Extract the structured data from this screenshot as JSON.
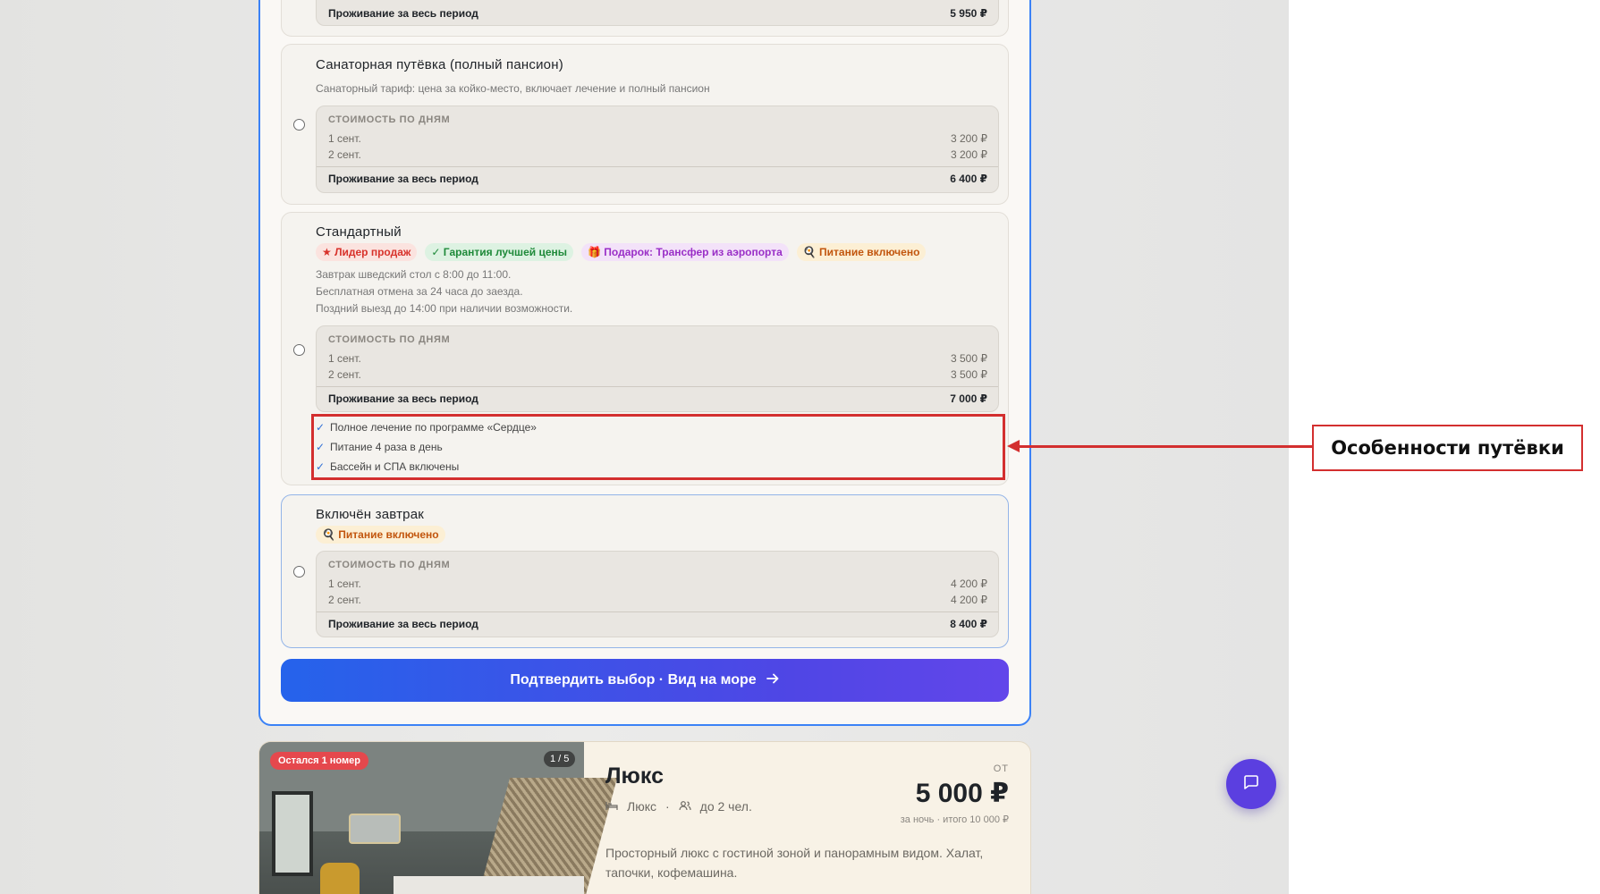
{
  "options": [
    {
      "title": "",
      "total_label": "Проживание за весь период",
      "total_value": "5 950 ₽"
    },
    {
      "title": "Санаторная путёвка (полный пансион)",
      "description": "Санаторный тариф: цена за койко-место, включает лечение и полный пансион",
      "price_header": "СТОИМОСТЬ ПО ДНЯМ",
      "days": [
        {
          "date": "1 сент.",
          "price": "3 200 ₽"
        },
        {
          "date": "2 сент.",
          "price": "3 200 ₽"
        }
      ],
      "total_label": "Проживание за весь период",
      "total_value": "6 400 ₽"
    },
    {
      "title": "Стандартный",
      "badges": [
        {
          "text": "★ Лидер продаж",
          "color": "#d8322b"
        },
        {
          "text": "✓ Гарантия лучшей цены",
          "color": "#1f8a3a"
        },
        {
          "text": "🎁 Подарок: Трансфер из аэропорта",
          "color": "#9a2fc7"
        },
        {
          "text": "🍳 Питание включено",
          "color": "#c2560e"
        }
      ],
      "description_lines": [
        "Завтрак шведский стол с 8:00 до 11:00.",
        "Бесплатная отмена за 24 часа до заезда.",
        "Поздний выезд до 14:00 при наличии возможности."
      ],
      "price_header": "СТОИМОСТЬ ПО ДНЯМ",
      "days": [
        {
          "date": "1 сент.",
          "price": "3 500 ₽"
        },
        {
          "date": "2 сент.",
          "price": "3 500 ₽"
        }
      ],
      "total_label": "Проживание за весь период",
      "total_value": "7 000 ₽",
      "features": [
        "Полное лечение по программе «Сердце»",
        "Питание 4 раза в день",
        "Бассейн и СПА включены"
      ]
    },
    {
      "title": "Включён завтрак",
      "badges": [
        {
          "text": "🍳 Питание включено",
          "color": "#c2560e"
        }
      ],
      "price_header": "СТОИМОСТЬ ПО ДНЯМ",
      "days": [
        {
          "date": "1 сент.",
          "price": "4 200 ₽"
        },
        {
          "date": "2 сент.",
          "price": "4 200 ₽"
        }
      ],
      "total_label": "Проживание за весь период",
      "total_value": "8 400 ₽"
    }
  ],
  "confirm_button": "Подтвердить выбор · Вид на море",
  "room": {
    "tag_left": "Остался 1 номер",
    "tag_right": "1 / 5",
    "title": "Люкс",
    "type": "Люкс",
    "guests": "до 2 чел.",
    "from_label": "ОТ",
    "price": "5 000 ₽",
    "price_sub": "за ночь · итого 10 000 ₽",
    "description": "Просторный люкс с гостиной зоной и панорамным видом. Халат, тапочки, кофемашина."
  },
  "annotation": {
    "label": "Особенности путёвки",
    "color": "#d32f2f"
  },
  "colors": {
    "accent": "#3b82f6",
    "chat": "#5b3fe0"
  }
}
